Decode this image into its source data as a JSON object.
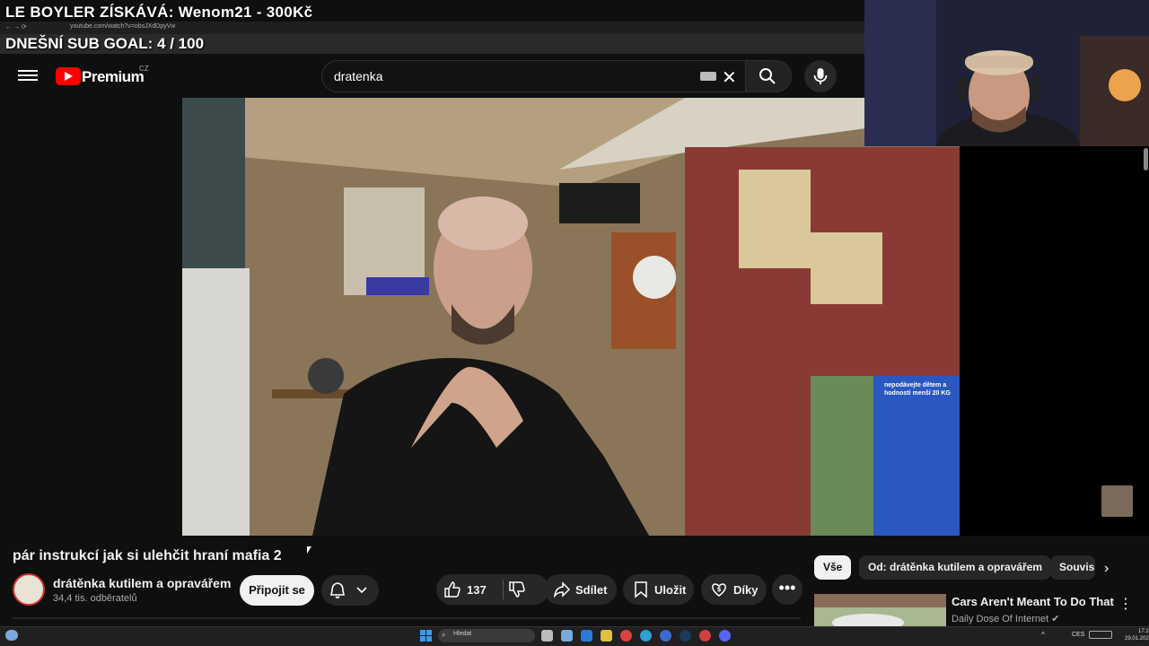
{
  "overlay": {
    "donation": "LE BOYLER ZÍSKÁVÁ: Wenom21 - 300Kč",
    "sub_goal": "DNEŠNÍ SUB GOAL: 4 / 100",
    "browser_url": "youtube.com/watch?v=obsJXdDpyVw"
  },
  "header": {
    "brand": "Premium",
    "region": "CZ",
    "search_value": "dratenka"
  },
  "video": {
    "title": "pár instrukcí jak si ulehčit hraní mafia 2",
    "sign_text": "nepodávejte dětem a\nhodnosti menší 20 KG"
  },
  "channel": {
    "name": "drátěnka kutilem a opravářem",
    "subscribers": "34,4 tis. odběratelů",
    "join_label": "Připojit se"
  },
  "actions": {
    "likes": "137",
    "share": "Sdílet",
    "save": "Uložit",
    "thanks": "Díky"
  },
  "chips": {
    "all": "Vše",
    "from_channel": "Od: drátěnka kutilem a opravářem",
    "related": "Související"
  },
  "recommended": {
    "title": "Cars Aren't Meant To Do That",
    "channel": "Daily Dose Of Internet"
  },
  "taskbar": {
    "search_placeholder": "Hledat",
    "language": "CES",
    "time": "17:25",
    "date": "29.01.2026"
  },
  "colors": {
    "background": "#0f0f0f",
    "yt_red": "#ff0000",
    "pill": "#272727"
  }
}
